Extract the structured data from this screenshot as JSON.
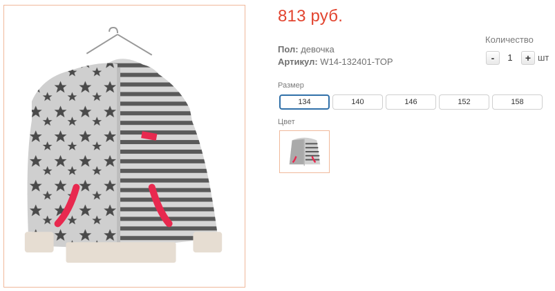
{
  "product": {
    "price": "813 руб.",
    "main_image_alt": "",
    "attributes": [
      {
        "label": "Пол:",
        "value": "девочка"
      },
      {
        "label": "Артикул:",
        "value": "W14-132401-TOP"
      }
    ]
  },
  "quantity": {
    "label": "Количество",
    "minus": "-",
    "plus": "+",
    "value": "1",
    "unit": "шт"
  },
  "size": {
    "label": "Размер",
    "options": [
      "134",
      "140",
      "146",
      "152",
      "158"
    ],
    "selected": "134"
  },
  "color": {
    "label": "Цвет"
  },
  "colors": {
    "price": "#e2442f",
    "selected_border": "#2f6fa8",
    "image_border": "#f0b89a",
    "accent_pink": "#e8294f"
  }
}
